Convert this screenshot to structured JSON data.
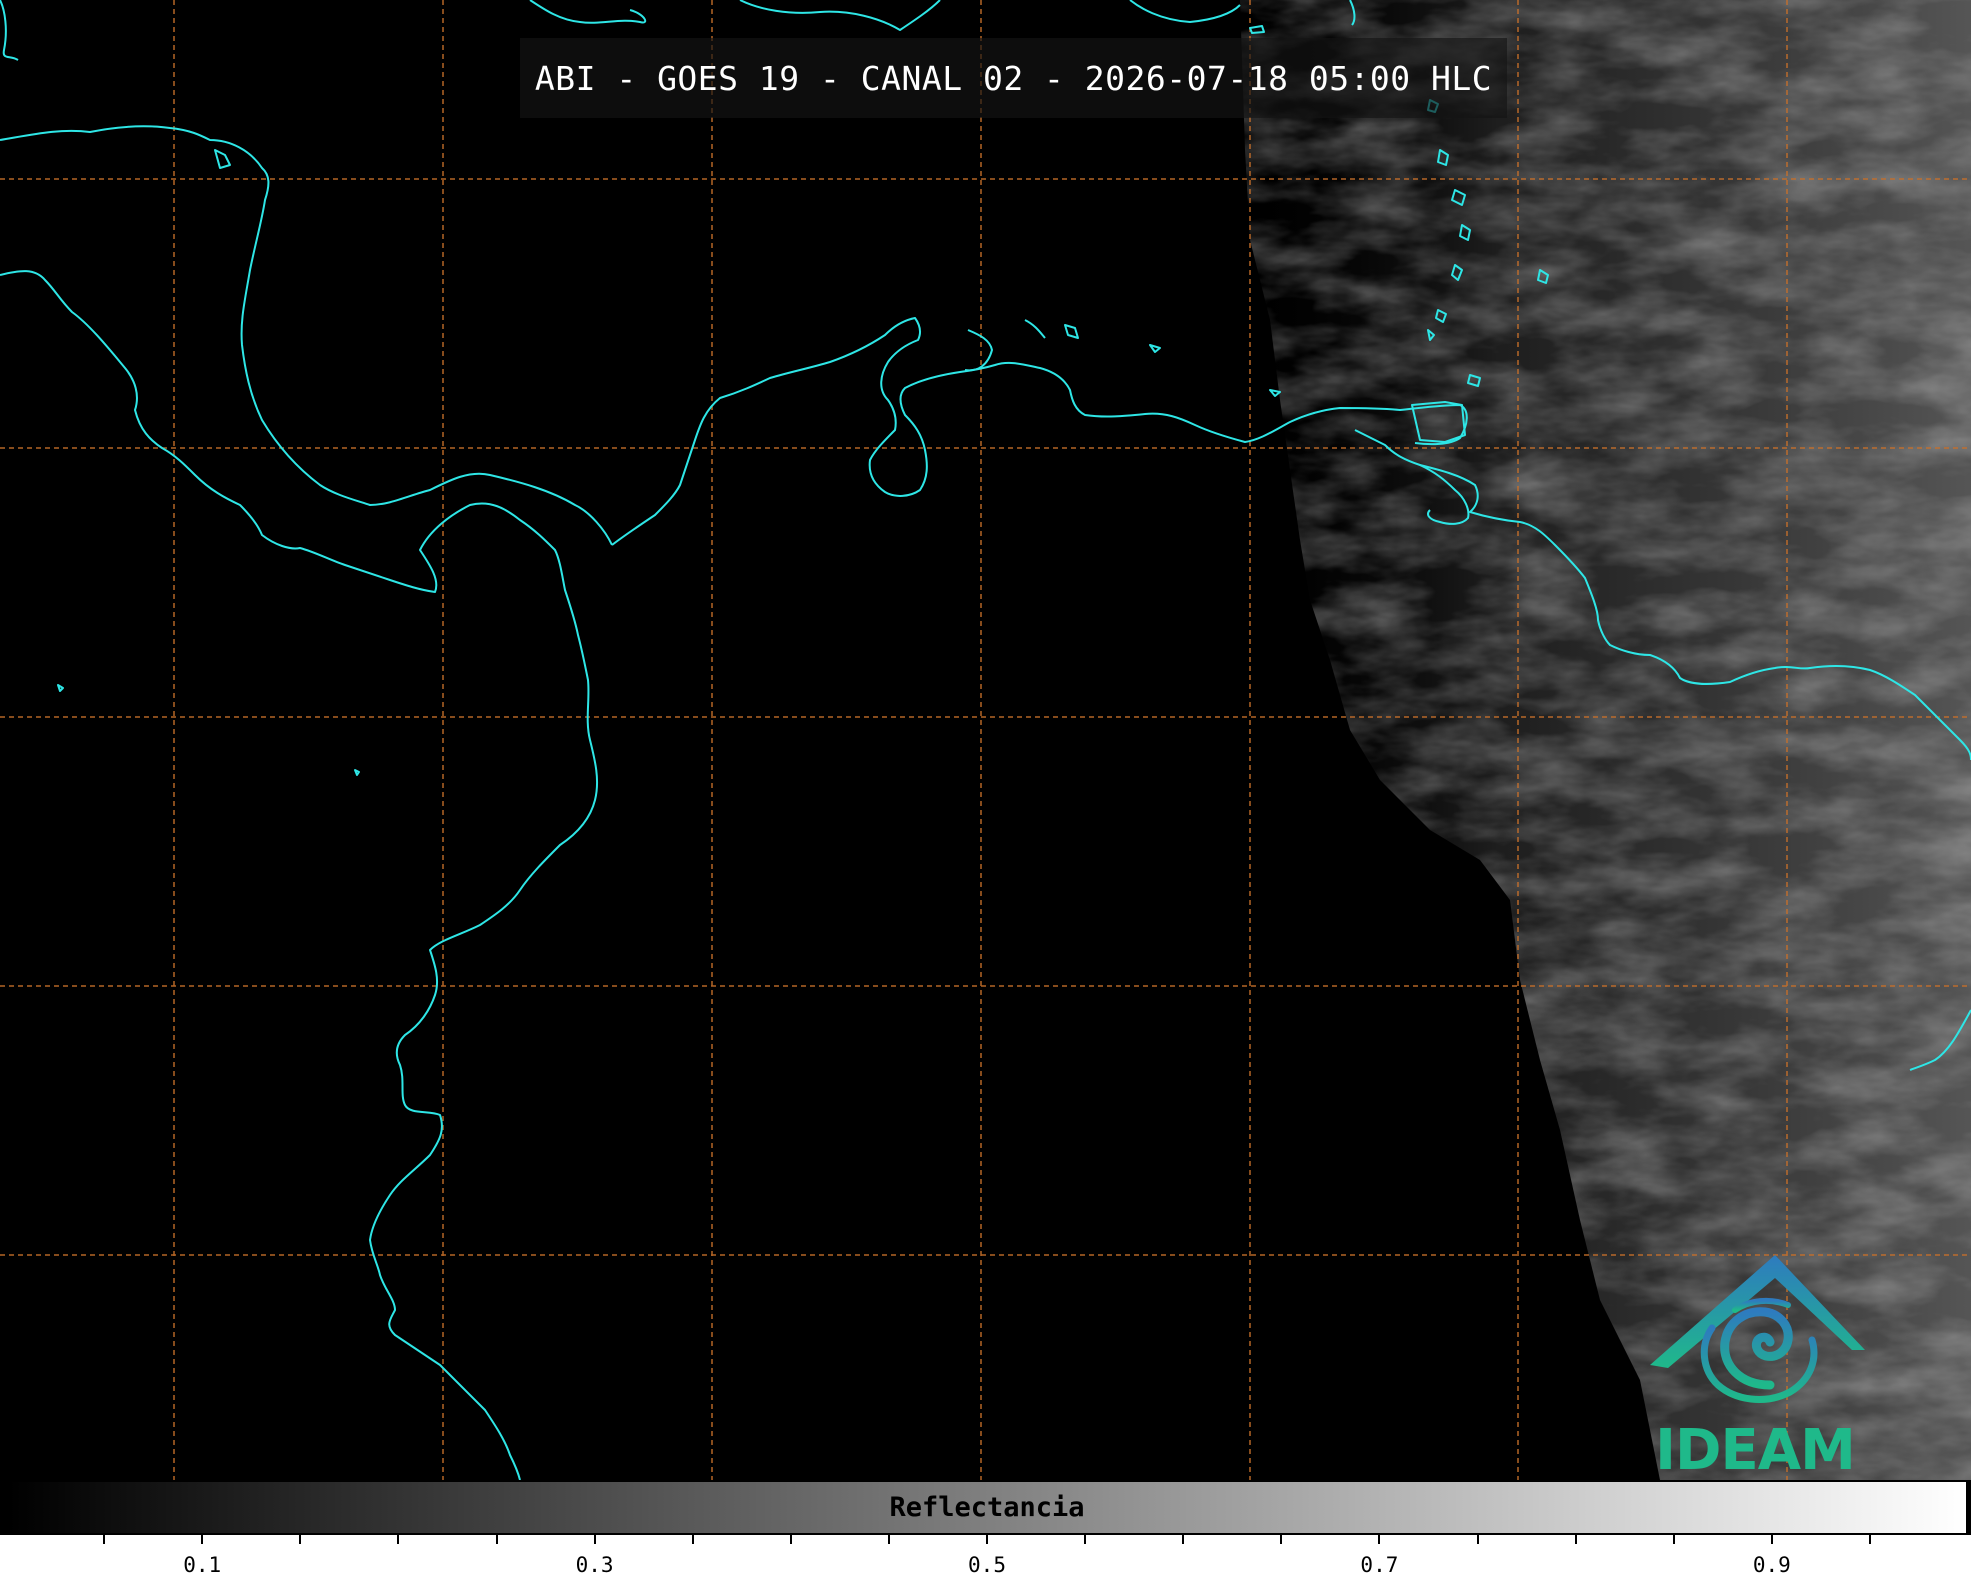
{
  "title": "ABI - GOES 19 - CANAL 02 - 2026-07-18 05:00 HLC",
  "colorbar": {
    "label": "Reflectancia",
    "range": [
      0.0,
      1.0
    ],
    "colormap": "grayscale black to white",
    "ticks": [
      {
        "value": 0.1,
        "label": "0.1"
      },
      {
        "value": 0.3,
        "label": "0.3"
      },
      {
        "value": 0.5,
        "label": "0.5"
      },
      {
        "value": 0.7,
        "label": "0.7"
      },
      {
        "value": 0.9,
        "label": "0.9"
      }
    ],
    "minor_tick_step": 0.05
  },
  "logo": {
    "text": "IDEAM",
    "icon": "ideam-logo-icon"
  },
  "colors": {
    "coastline": "#2ee6e6",
    "gridline": "#c8702a",
    "background": "#000000",
    "logo_blue": "#2e7bbf",
    "logo_green": "#1fb98a"
  },
  "map": {
    "gridlines": "dashed",
    "cloud_field": "bright reflectance to the east"
  }
}
